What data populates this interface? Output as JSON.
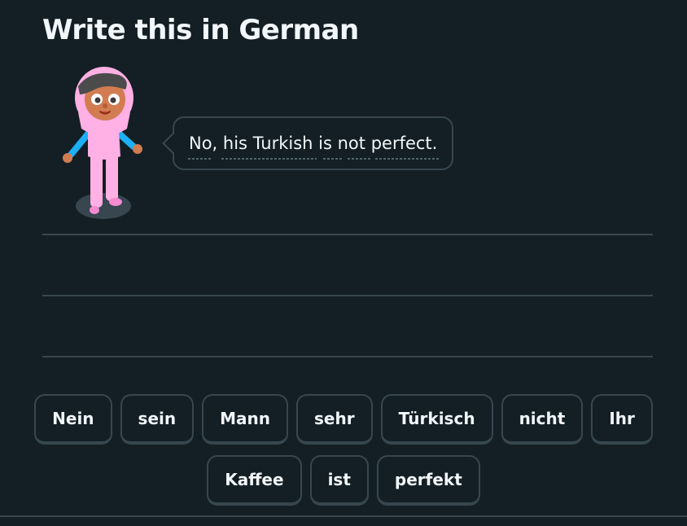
{
  "header": {
    "title": "Write this in German"
  },
  "prompt": {
    "sentence": "No, his Turkish is not perfect."
  },
  "word_bank": {
    "row1": [
      "Nein",
      "sein",
      "Mann",
      "sehr",
      "Türkisch",
      "nicht",
      "Ihr"
    ],
    "row2": [
      "Kaffee",
      "ist",
      "perfekt"
    ]
  },
  "colors": {
    "background": "#131f24",
    "border": "#37464f",
    "text": "#f1f7fb",
    "underline_dots": "#52656d"
  },
  "icons": {
    "character": "character-hijab-girl-icon"
  }
}
